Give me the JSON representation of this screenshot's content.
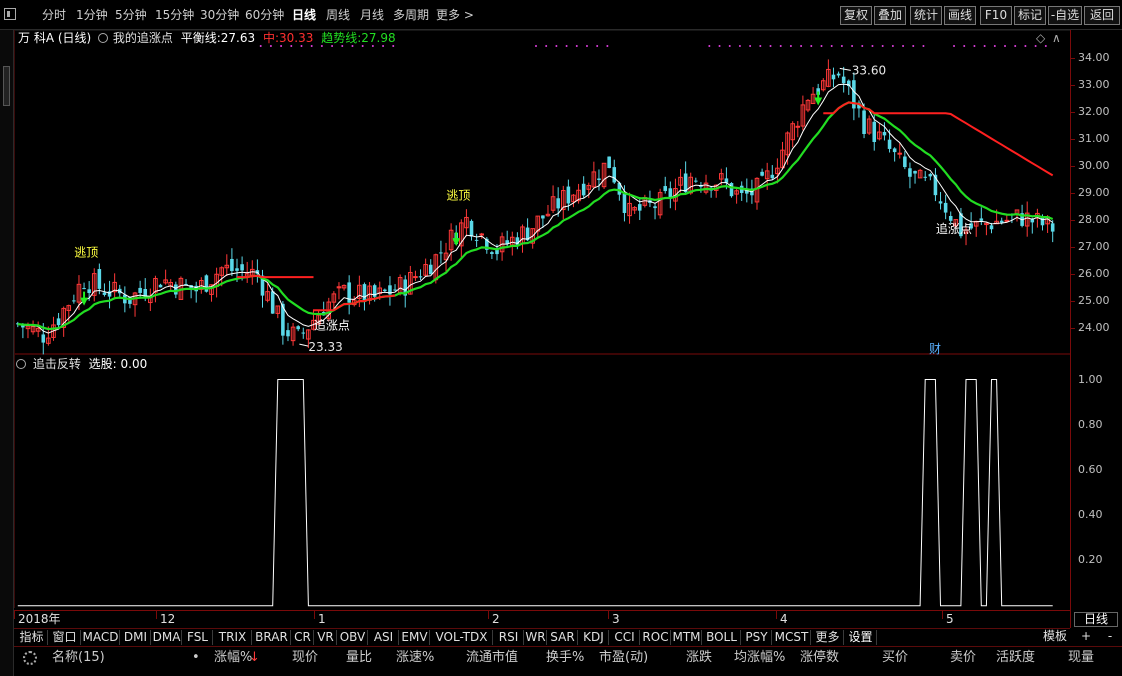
{
  "toolbar": {
    "periods": [
      "分时",
      "1分钟",
      "5分钟",
      "15分钟",
      "30分钟",
      "60分钟",
      "日线",
      "周线",
      "月线",
      "多周期",
      "更多 >"
    ],
    "active_period": "日线",
    "right_buttons": [
      "复权",
      "叠加",
      "统计",
      "画线",
      "F10",
      "标记",
      "-自选",
      "返回"
    ]
  },
  "main": {
    "stock_name": "万 科A",
    "period_tag": "(日线)",
    "indicator_name": "我的追涨点",
    "balance_label": "平衡线:",
    "balance_value": "27.63",
    "mid_label": "中:",
    "mid_value": "30.33",
    "trend_label": "趋势线:",
    "trend_value": "27.98",
    "high_label": "33.60",
    "low_label": "23.33",
    "signals": [
      {
        "text": "逃顶",
        "i": 13
      },
      {
        "text": "逃顶",
        "i": 86
      },
      {
        "text": "追涨点",
        "i": 60
      },
      {
        "text": "追涨点",
        "i": 182
      }
    ],
    "cai_badge": "财"
  },
  "sub": {
    "indicator_name": "追击反转",
    "pick_label": "选股:",
    "pick_value": "0.00"
  },
  "date_axis": {
    "labels": [
      "2018年",
      "12",
      "1",
      "2",
      "3",
      "4",
      "5"
    ],
    "period_btn": "日线"
  },
  "tabs": [
    "指标",
    "窗口",
    "MACD",
    "DMI",
    "DMA",
    "FSL",
    "TRIX",
    "BRAR",
    "CR",
    "VR",
    "OBV",
    "ASI",
    "EMV",
    "VOL-TDX",
    "RSI",
    "WR",
    "SAR",
    "KDJ",
    "CCI",
    "ROC",
    "MTM",
    "BOLL",
    "PSY",
    "MCST",
    "更多",
    "设置"
  ],
  "tab_right": [
    "模板",
    "+",
    "-"
  ],
  "list_header": [
    "名称(15)",
    "•",
    "涨幅%",
    "现价",
    "量比",
    "涨速%",
    "流通市值",
    "换手%",
    "市盈(动)",
    "涨跌",
    "均涨幅%",
    "涨停数",
    "买价",
    "卖价",
    "活跃度",
    "现量"
  ],
  "chart_data": [
    {
      "type": "candlestick",
      "title": "我的追涨点",
      "y_ticks": [
        34.0,
        33.0,
        32.0,
        31.0,
        30.0,
        29.0,
        28.0,
        27.0,
        26.0,
        25.0,
        24.0
      ],
      "ylim": [
        23.0,
        34.5
      ],
      "anchors": [
        [
          0,
          24.15
        ],
        [
          5,
          23.75
        ],
        [
          8,
          24.4
        ],
        [
          13,
          25.8
        ],
        [
          16,
          25.5
        ],
        [
          22,
          25.1
        ],
        [
          28,
          25.8
        ],
        [
          35,
          25.4
        ],
        [
          40,
          26.2
        ],
        [
          47,
          26.0
        ],
        [
          52,
          24.0
        ],
        [
          55,
          23.6
        ],
        [
          60,
          24.8
        ],
        [
          64,
          25.3
        ],
        [
          70,
          25.1
        ],
        [
          76,
          25.6
        ],
        [
          82,
          26.6
        ],
        [
          88,
          28.0
        ],
        [
          94,
          26.9
        ],
        [
          100,
          27.6
        ],
        [
          106,
          28.6
        ],
        [
          112,
          29.5
        ],
        [
          116,
          30.1
        ],
        [
          120,
          28.2
        ],
        [
          126,
          28.6
        ],
        [
          132,
          29.6
        ],
        [
          138,
          29.4
        ],
        [
          142,
          28.8
        ],
        [
          146,
          29.2
        ],
        [
          150,
          30.6
        ],
        [
          155,
          32.6
        ],
        [
          161,
          33.4
        ],
        [
          166,
          31.6
        ],
        [
          170,
          30.8
        ],
        [
          175,
          29.6
        ],
        [
          180,
          29.1
        ],
        [
          185,
          27.6
        ],
        [
          191,
          27.9
        ],
        [
          197,
          28.1
        ],
        [
          203,
          27.7
        ]
      ],
      "count": 204,
      "series": [
        {
          "name": "平衡线",
          "color": "#ffffff"
        },
        {
          "name": "趋势线",
          "color": "#22dd22"
        },
        {
          "name": "中",
          "color": "#ff2020"
        }
      ]
    },
    {
      "type": "line",
      "title": "追击反转",
      "y_ticks": [
        1.0,
        0.8,
        0.6,
        0.4,
        0.2
      ],
      "ylim": [
        -0.01,
        1.02
      ],
      "spikes": [
        [
          51,
          56
        ],
        [
          178,
          180
        ],
        [
          186,
          188
        ],
        [
          191,
          192
        ]
      ]
    }
  ]
}
